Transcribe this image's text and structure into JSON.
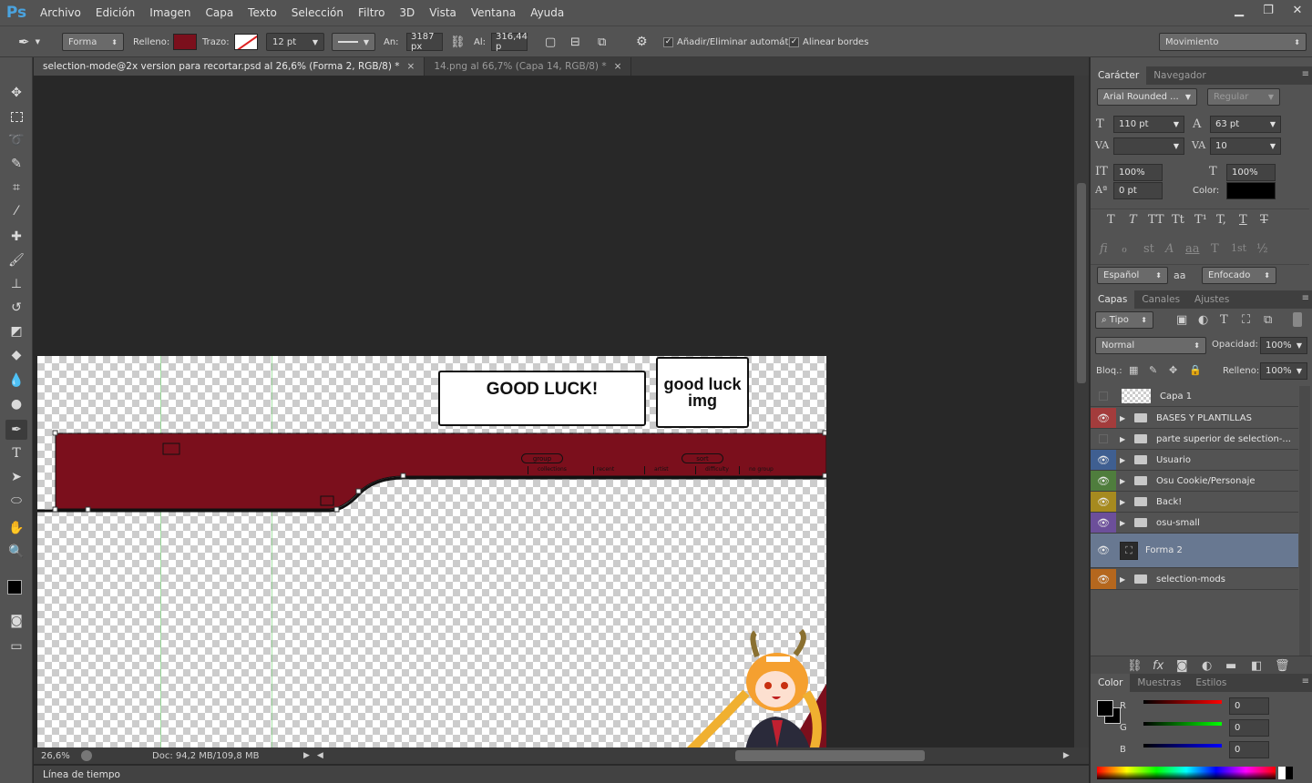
{
  "app": {
    "logo": "Ps"
  },
  "menu": [
    "Archivo",
    "Edición",
    "Imagen",
    "Capa",
    "Texto",
    "Selección",
    "Filtro",
    "3D",
    "Vista",
    "Ventana",
    "Ayuda"
  ],
  "window_controls": {
    "minimize": "▁",
    "restore": "❐",
    "close": "✕"
  },
  "options": {
    "mode": "Forma",
    "fill_label": "Relleno:",
    "fill_color": "#7b0f1c",
    "stroke_label": "Trazo:",
    "stroke_width": "12 pt",
    "width_label": "An:",
    "width_value": "3187 px",
    "height_label": "Al:",
    "height_value": "316,44 p",
    "auto_add_delete": "Añadir/Eliminar automát.",
    "align_edges": "Alinear bordes",
    "workspace": "Movimiento"
  },
  "tabs": [
    {
      "label": "selection-mode@2x version para recortar.psd  al 26,6% (Forma 2, RGB/8) *",
      "active": true
    },
    {
      "label": "14.png al 66,7% (Capa 14, RGB/8) *",
      "active": false
    }
  ],
  "canvas": {
    "good_luck": "GOOD LUCK!",
    "good_luck_img": "good luck img",
    "group_label": "group",
    "sort_label": "sort",
    "sub_labels": [
      "collections",
      "recent",
      "artist",
      "difficulty",
      "no group"
    ],
    "bar_color": "#7b0f1c"
  },
  "status": {
    "zoom": "26,6%",
    "doc": "Doc: 94,2 MB/109,8 MB"
  },
  "timeline": "Línea de tiempo",
  "character": {
    "tabs": [
      "Carácter",
      "Navegador"
    ],
    "font": "Arial Rounded ...",
    "style": "Regular",
    "size": "110 pt",
    "leading": "63 pt",
    "kerning": "",
    "tracking": "10",
    "vscale": "100%",
    "hscale": "100%",
    "baseline": "0 pt",
    "color_label": "Color:",
    "language": "Español",
    "antialias": "Enfocado",
    "aa_icon": "aa",
    "type_glyphs": [
      "T",
      "T",
      "TT",
      "Tt",
      "T¹",
      "T,",
      "T",
      "T"
    ],
    "ot_glyphs": [
      "fi",
      "ℴ",
      "st",
      "A",
      "aa",
      "T",
      "1st",
      "½"
    ]
  },
  "layers_panel": {
    "tabs": [
      "Capas",
      "Canales",
      "Ajustes"
    ],
    "filter": "Tipo",
    "blend": "Normal",
    "opacity_label": "Opacidad:",
    "opacity": "100%",
    "lock_label": "Bloq.:",
    "fill_label": "Relleno:",
    "fill": "100%",
    "layers": [
      {
        "name": "Capa 1",
        "visible": false,
        "color": "",
        "type": "pixel"
      },
      {
        "name": "BASES Y PLANTILLAS",
        "visible": true,
        "color": "#a33c3c",
        "type": "group"
      },
      {
        "name": "parte superior de selection-...",
        "visible": false,
        "color": "",
        "type": "group"
      },
      {
        "name": "Usuario",
        "visible": true,
        "color": "#3f5f91",
        "type": "group"
      },
      {
        "name": "Osu Cookie/Personaje",
        "visible": true,
        "color": "#4f7d3d",
        "type": "group"
      },
      {
        "name": "Back!",
        "visible": true,
        "color": "#a68a1f",
        "type": "group"
      },
      {
        "name": "osu-small",
        "visible": true,
        "color": "#6c4f9a",
        "type": "group"
      },
      {
        "name": "Forma 2",
        "visible": true,
        "color": "",
        "type": "shape",
        "selected": true
      },
      {
        "name": "selection-mods",
        "visible": true,
        "color": "#b5671e",
        "type": "group"
      }
    ]
  },
  "color_panel": {
    "tabs": [
      "Color",
      "Muestras",
      "Estilos"
    ],
    "r_label": "R",
    "g_label": "G",
    "b_label": "B",
    "r": "0",
    "g": "0",
    "b": "0"
  }
}
